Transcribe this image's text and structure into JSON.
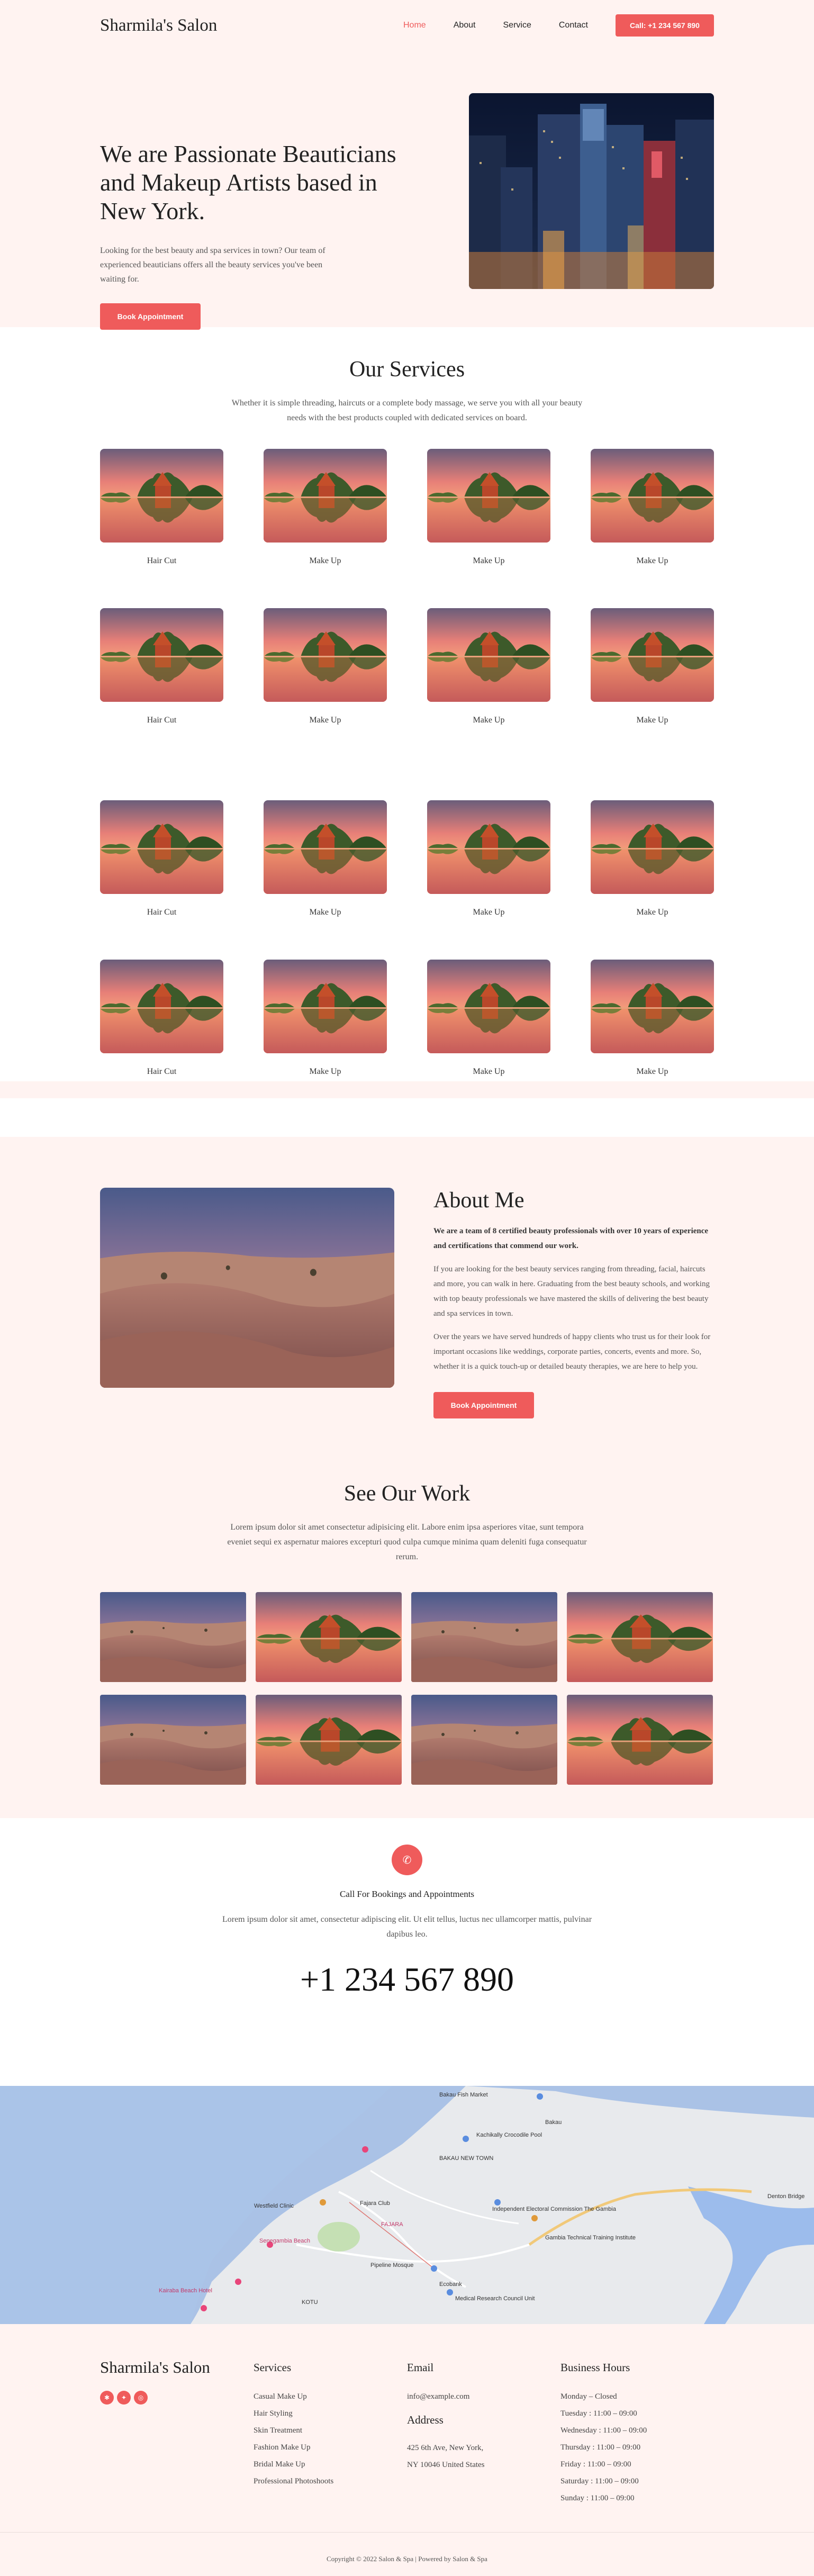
{
  "header": {
    "logo": "Sharmila's Salon",
    "nav": [
      "Home",
      "About",
      "Service",
      "Contact"
    ],
    "call_button": "Call: +1 234 567 890"
  },
  "hero": {
    "title": "We are Passionate Beauticians and Makeup Artists based in New York.",
    "description": "Looking for the best beauty and spa services in town? Our team of experienced beauticians offers all the beauty services you've been waiting for.",
    "button": "Book Appointment"
  },
  "services": {
    "title": "Our Services",
    "subtitle": "Whether it is simple threading, haircuts or a complete body massage, we serve you with all your beauty needs with the best products coupled with dedicated services on board.",
    "items": [
      "Hair Cut",
      "Make Up",
      "Make Up",
      "Make Up",
      "Hair Cut",
      "Make Up",
      "Make Up",
      "Make Up"
    ],
    "items_2": [
      "Hair Cut",
      "Make Up",
      "Make Up",
      "Make Up",
      "Hair Cut",
      "Make Up",
      "Make Up",
      "Make Up"
    ]
  },
  "about": {
    "title": "About Me",
    "lead": "We are a team of 8 certified beauty professionals with over 10 years of experience and certifications that commend our work.",
    "p1": "If you are looking for the best beauty services ranging from threading, facial, haircuts and more, you can walk in here. Graduating from the best beauty schools, and working with top beauty professionals we have mastered the skills of delivering the best beauty and spa services in town.",
    "p2": "Over the years we have served hundreds of happy clients who trust us for their look for important occasions like weddings, corporate parties, concerts, events and more. So, whether it is a quick touch-up or detailed beauty therapies, we are here to help you.",
    "button": "Book Appointment"
  },
  "work": {
    "title": "See Our Work",
    "subtitle": "Lorem ipsum dolor sit amet consectetur adipisicing elit. Labore enim ipsa asperiores vitae, sunt tempora eveniet sequi ex aspernatur maiores excepturi quod culpa cumque minima quam deleniti fuga consequatur rerum."
  },
  "booking": {
    "title": "Call For Bookings and Appointments",
    "text": "Lorem ipsum dolor sit amet, consectetur adipiscing elit. Ut elit tellus, luctus nec ullamcorper mattis, pulvinar dapibus leo.",
    "phone": "+1 234 567 890"
  },
  "map": {
    "labels": [
      "Bakau",
      "Kachikally Crocodile Pool",
      "BAKAU NEW TOWN",
      "Fajara Club",
      "Independent Electoral Commission The Gambia",
      "Westfield Clinic",
      "Senegambia Beach",
      "Pipeline Mosque",
      "Ecobank",
      "Kotu",
      "Medical Research Council Unit",
      "Gambia Technical Training Institute",
      "Denton Bridge",
      "FAJARA",
      "Bakau Fish Market",
      "Kairaba Beach Hotel",
      "KOTU"
    ]
  },
  "footer": {
    "brand": "Sharmila's Salon",
    "services_title": "Services",
    "services": [
      "Casual Make Up",
      "Hair Styling",
      "Skin Treatment",
      "Fashion Make Up",
      "Bridal Make Up",
      "Professional Photoshoots"
    ],
    "email_title": "Email",
    "email": "info@example.com",
    "address_title": "Address",
    "address_line1": "425 6th Ave, New York,",
    "address_line2": "NY 10046 United States",
    "hours_title": "Business Hours",
    "hours": [
      "Monday – Closed",
      "Tuesday : 11:00 – 09:00",
      "Wednesday : 11:00 – 09:00",
      "Thursday : 11:00 – 09:00",
      "Friday : 11:00 – 09:00",
      "Saturday : 11:00 – 09:00",
      "Sunday : 11:00 – 09:00"
    ],
    "copyright": "Copyright © 2022 Salon & Spa | Powered by Salon & Spa"
  },
  "colors": {
    "accent": "#ef5b5b",
    "pink_bg": "#fff3f1"
  },
  "icons": [
    "phone-icon",
    "yelp-icon",
    "twitter-icon",
    "instagram-icon"
  ]
}
